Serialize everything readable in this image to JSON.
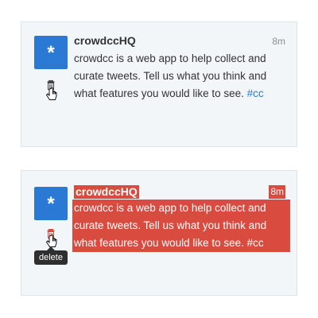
{
  "tweets": [
    {
      "avatar_glyph": "*",
      "author": "crowdccHQ",
      "time": "8m",
      "text": "crowdcc is a web app to help collect and curate tweets. Tell us what you think and what features you would like to see. ",
      "hashtag": "#cc",
      "state": "normal"
    },
    {
      "avatar_glyph": "*",
      "author": "crowdccHQ",
      "time": "8m",
      "text": "crowdcc is a web app to help collect and curate tweets. Tell us what you think and what features you would like to see. ",
      "hashtag": "#cc",
      "state": "highlighted",
      "tooltip": "delete"
    }
  ],
  "colors": {
    "avatar": "#2a7ad5",
    "highlight": "#d94b3e",
    "hashtag": "#2a7ad5",
    "card_bg": "#f3f6f9"
  },
  "icons": [
    "trash-icon",
    "hand-cursor-icon"
  ]
}
